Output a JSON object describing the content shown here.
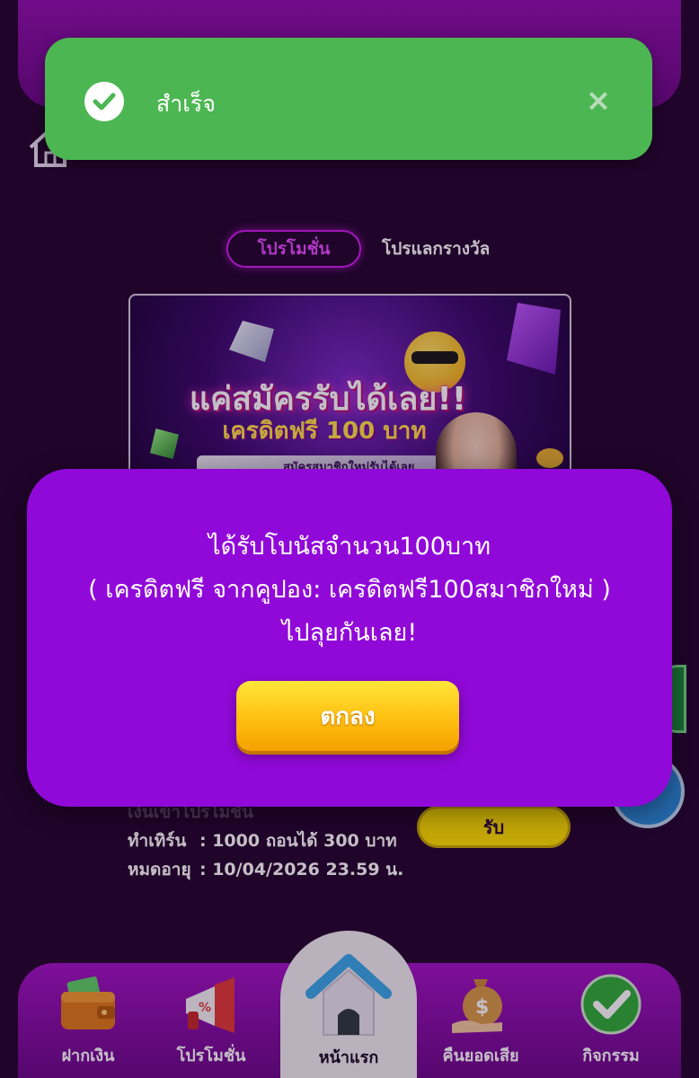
{
  "toast": {
    "message": "สำเร็จ",
    "close_symbol": "×",
    "icon": "check-circle-icon"
  },
  "tabs": {
    "promotion": "โปรโมชั่น",
    "reward_exchange": "โปรแลกรางวัล"
  },
  "banner": {
    "headline": "แค่สมัครรับได้เลย!!",
    "subheadline": "เครดิตฟรี 100 บาท",
    "strip_text": "สมัครสมาชิกใหม่รับได้เลย"
  },
  "dialog": {
    "line1": "ได้รับโบนัสจำนวน100บาท",
    "line2": "( เครดิตฟรี จากคูปอง: เครดิตฟรี100สมาชิกใหม่ )",
    "line3": "ไปลุยกันเลย!",
    "ok_label": "ตกลง"
  },
  "promo_info": {
    "partial_label": "เงินเข้าโปรโมชั่น",
    "turnover_key": "ทำเทิร์น",
    "turnover_value": ": 1000 ถอนได้ 300 บาท",
    "expiry_key": "หมดอายุ",
    "expiry_value": ": 10/04/2026 23.59 น.",
    "claim_label": "รับ"
  },
  "bottom_nav": {
    "deposit": "ฝากเงิน",
    "promotion": "โปรโมชั่น",
    "home": "หน้าแรก",
    "cashback": "คืนยอดเสีย",
    "activities": "กิจกรรม"
  },
  "colors": {
    "toast_green": "#4cb752",
    "dialog_purple": "#9109d9",
    "ok_button_gold": "#ffbf10",
    "claim_yellow": "#ffe100",
    "nav_purple": "#a214c4",
    "page_bg": "#24062f"
  }
}
